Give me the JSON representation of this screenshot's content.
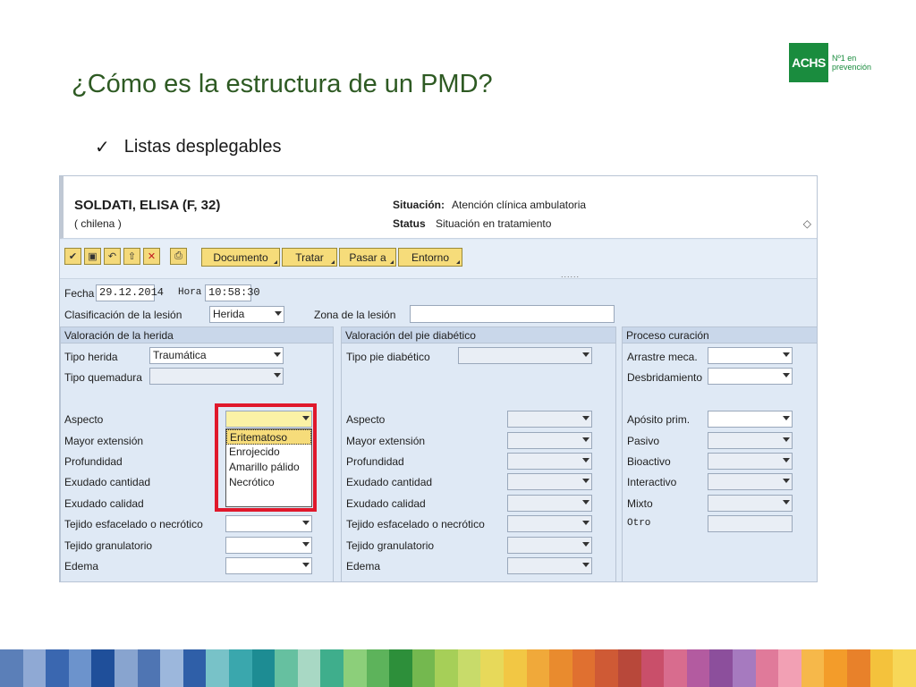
{
  "slide": {
    "title": "¿Cómo es la estructura de un PMD?",
    "bullet_check": "✓",
    "bullet": "Listas desplegables",
    "logo_text": "ACHS",
    "logo_tag_1": "Nº1 en",
    "logo_tag_2": "prevención"
  },
  "patient": {
    "name": "SOLDATI, ELISA (F, 32)",
    "nationality": "( chilena )",
    "situacion_label": "Situación:",
    "situacion_value": "Atención clínica ambulatoria",
    "status_label": "Status",
    "status_value": "Situación en tratamiento"
  },
  "toolbar": {
    "buttons": [
      "Documento",
      "Tratar",
      "Pasar a",
      "Entorno"
    ],
    "icons": [
      "save-check-icon",
      "save-icon",
      "back-icon",
      "exit-icon",
      "cancel-icon",
      "print-icon"
    ],
    "dots": "......"
  },
  "header_fields": {
    "fecha_label": "Fecha",
    "fecha_value": "29.12.2014",
    "hora_label": "Hora",
    "hora_value": "10:58:30",
    "clasificacion_label": "Clasificación de la lesión",
    "clasificacion_value": "Herida",
    "zona_label": "Zona de la lesión",
    "zona_value": ""
  },
  "panels": {
    "herida": {
      "title": "Valoración de la herida",
      "tipo_herida_label": "Tipo herida",
      "tipo_herida_value": "Traumática",
      "tipo_quemadura_label": "Tipo quemadura",
      "rows": [
        "Aspecto",
        "Mayor extensión",
        "Profundidad",
        "Exudado cantidad",
        "Exudado calidad",
        "Tejido esfacelado o necrótico",
        "Tejido granulatorio",
        "Edema"
      ]
    },
    "pie": {
      "title": "Valoración del pie diabético",
      "tipo_pie_label": "Tipo pie diabético",
      "rows": [
        "Aspecto",
        "Mayor extensión",
        "Profundidad",
        "Exudado cantidad",
        "Exudado calidad",
        "Tejido esfacelado o necrótico",
        "Tejido granulatorio",
        "Edema"
      ]
    },
    "curacion": {
      "title": "Proceso curación",
      "top_rows": [
        "Arrastre meca.",
        "Desbridamiento"
      ],
      "rows": [
        "Apósito prim.",
        "Pasivo",
        "Bioactivo",
        "Interactivo",
        "Mixto",
        "Otro"
      ]
    }
  },
  "dropdown": {
    "options": [
      "Eritematoso",
      "Enrojecido",
      "Amarillo pálido",
      "Necrótico"
    ],
    "selected": "Eritematoso"
  },
  "colors": {
    "title_green": "#2e5a23",
    "logo_green": "#1a8c3e",
    "highlight_red": "#e0182b",
    "sap_button": "#f6dc7a",
    "panel_bg": "#dfe9f5"
  },
  "footer_stripe_colors": [
    "#5b7fb8",
    "#8fa9d4",
    "#3a67b0",
    "#6c93cc",
    "#1f4f9a",
    "#88a4cf",
    "#4f75b3",
    "#9cb7dc",
    "#2f5fa8",
    "#78c2c8",
    "#3aa7ad",
    "#1d8c93",
    "#66c0a0",
    "#a8d8c4",
    "#3fae8c",
    "#8ccf7a",
    "#5db35b",
    "#2d8f3a",
    "#74b84f",
    "#a6cf58",
    "#c8db6a",
    "#e7d95a",
    "#f2c744",
    "#f0a93a",
    "#e98b2e",
    "#e07030",
    "#cf5a35",
    "#b8483a",
    "#c94f6a",
    "#d86c8e",
    "#b35ba0",
    "#8c4f9c",
    "#a67abf",
    "#e07a9a",
    "#f2a0b4",
    "#f6b84a",
    "#f39c2a",
    "#e8812a",
    "#f4c23c",
    "#f7d758"
  ]
}
